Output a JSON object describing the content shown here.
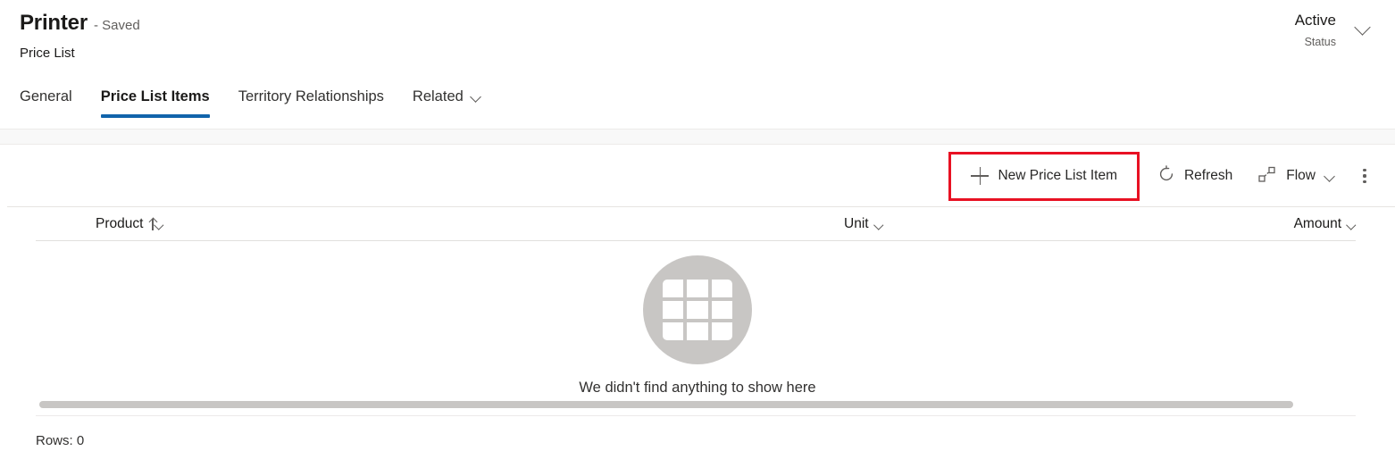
{
  "record_header": {
    "title": "Printer",
    "saved_state": "- Saved",
    "subtitle": "Price List",
    "status_value": "Active",
    "status_label": "Status"
  },
  "tabs": [
    {
      "label": "General",
      "active": false,
      "has_chevron": false
    },
    {
      "label": "Price List Items",
      "active": true,
      "has_chevron": false
    },
    {
      "label": "Territory Relationships",
      "active": false,
      "has_chevron": false
    },
    {
      "label": "Related",
      "active": false,
      "has_chevron": true
    }
  ],
  "command_bar": {
    "new_item_label": "New Price List Item",
    "new_item_icon": "plus-icon",
    "refresh_label": "Refresh",
    "refresh_icon": "refresh-icon",
    "flow_label": "Flow",
    "flow_icon": "flow-icon",
    "overflow_icon": "more-vertical-icon",
    "highlight_color": "#e81123"
  },
  "grid": {
    "columns": [
      {
        "label": "Product",
        "sorted": "ascending",
        "sort_icon": "arrow-up-icon"
      },
      {
        "label": "Unit",
        "sorted": "none"
      },
      {
        "label": "Amount",
        "sorted": "none"
      }
    ],
    "empty_message": "We didn't find anything to show here",
    "empty_icon": "table-grid-icon",
    "rows_label": "Rows: 0"
  },
  "theme": {
    "accent": "#1164ab",
    "text_primary": "#1b1a19",
    "text_secondary": "#605e5c",
    "empty_circle": "#c8c6c4"
  }
}
